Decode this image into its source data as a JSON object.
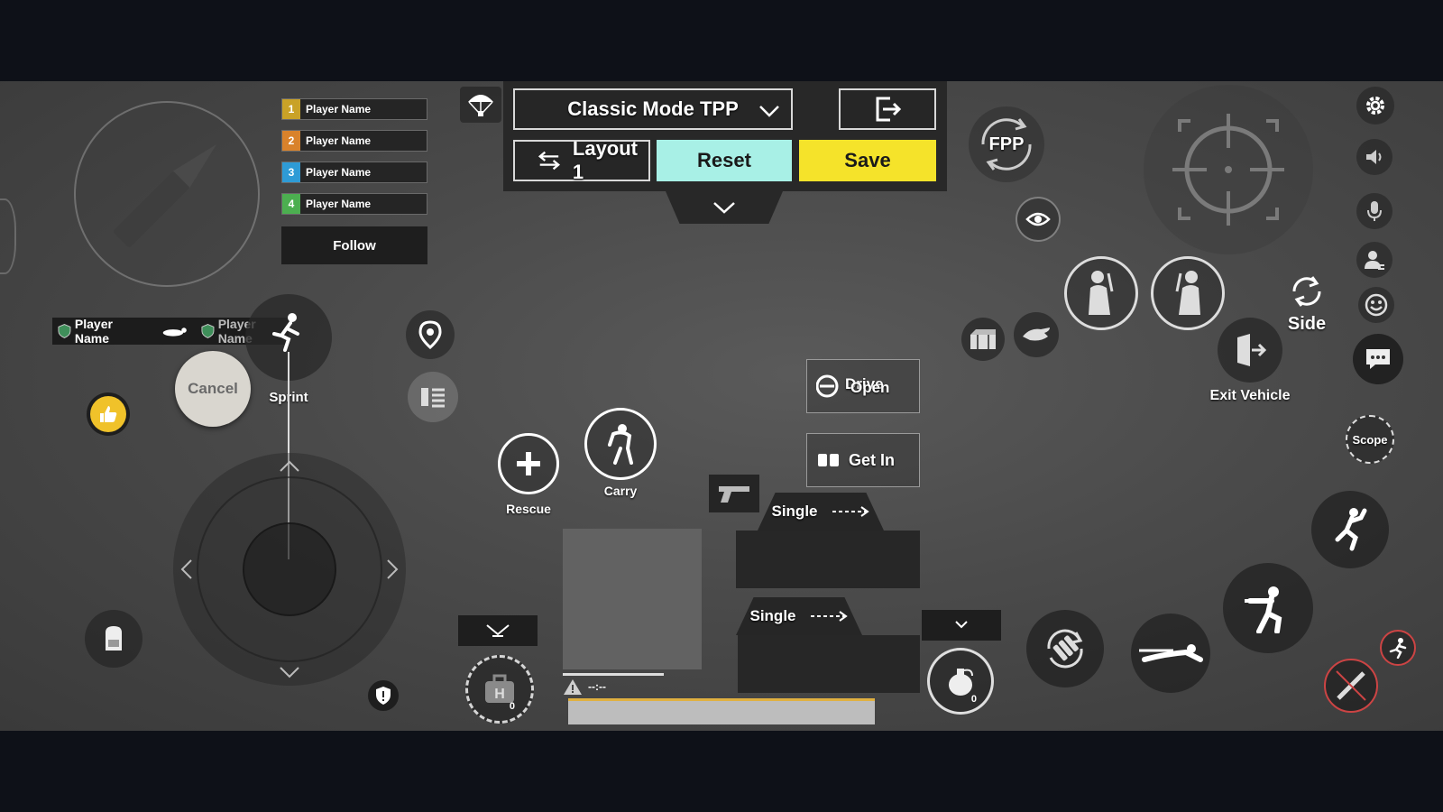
{
  "top_menu": {
    "mode_label": "Classic Mode TPP",
    "layout_label": "Layout 1",
    "reset_label": "Reset",
    "save_label": "Save"
  },
  "team": {
    "players": [
      {
        "num": "1",
        "name": "Player Name",
        "color": "#c9a227"
      },
      {
        "num": "2",
        "name": "Player Name",
        "color": "#d9822b"
      },
      {
        "num": "3",
        "name": "Player Name",
        "color": "#2e9bd6"
      },
      {
        "num": "4",
        "name": "Player Name",
        "color": "#4caf50"
      }
    ],
    "follow_label": "Follow"
  },
  "knock_feed": {
    "player1": "Player Name",
    "player2": "Player Name"
  },
  "left": {
    "cancel_label": "Cancel",
    "sprint_label": "Sprint"
  },
  "center": {
    "rescue_label": "Rescue",
    "carry_label": "Carry",
    "drive_label": "Drive",
    "open_label": "Open",
    "get_in_label": "Get In",
    "fire_mode_1": "Single",
    "fire_mode_2": "Single",
    "ammo_text": "--:--",
    "heal_count": "0",
    "throw_count": "0"
  },
  "right": {
    "fpp_label": "FPP",
    "side_label": "Side",
    "exit_vehicle_label": "Exit Vehicle",
    "scope_label": "Scope"
  },
  "colors": {
    "reset_bg": "#a8f0e6",
    "save_bg": "#f5e32a",
    "thumb_bg": "#f0c22a"
  },
  "icons": [
    "bullet-icon",
    "parachute-icon",
    "exit-icon",
    "swap-icon",
    "chevron-down-icon",
    "location-pin-icon",
    "vehicle-list-icon",
    "thumbs-up-icon",
    "backpack-icon",
    "shield-icon",
    "plus-icon",
    "carry-icon",
    "pistol-icon",
    "fpp-cycle-icon",
    "eye-icon",
    "crosshair-icon",
    "lean-left-icon",
    "lean-right-icon",
    "crate-icon",
    "hand-icon",
    "door-icon",
    "gear-icon",
    "speaker-icon",
    "mic-icon",
    "teammate-icon",
    "emoji-icon",
    "chat-icon",
    "rotate-icon",
    "jump-icon",
    "crouch-icon",
    "prone-icon",
    "reload-icon",
    "melee-icon",
    "run-icon",
    "heal-icon",
    "grenade-icon"
  ]
}
